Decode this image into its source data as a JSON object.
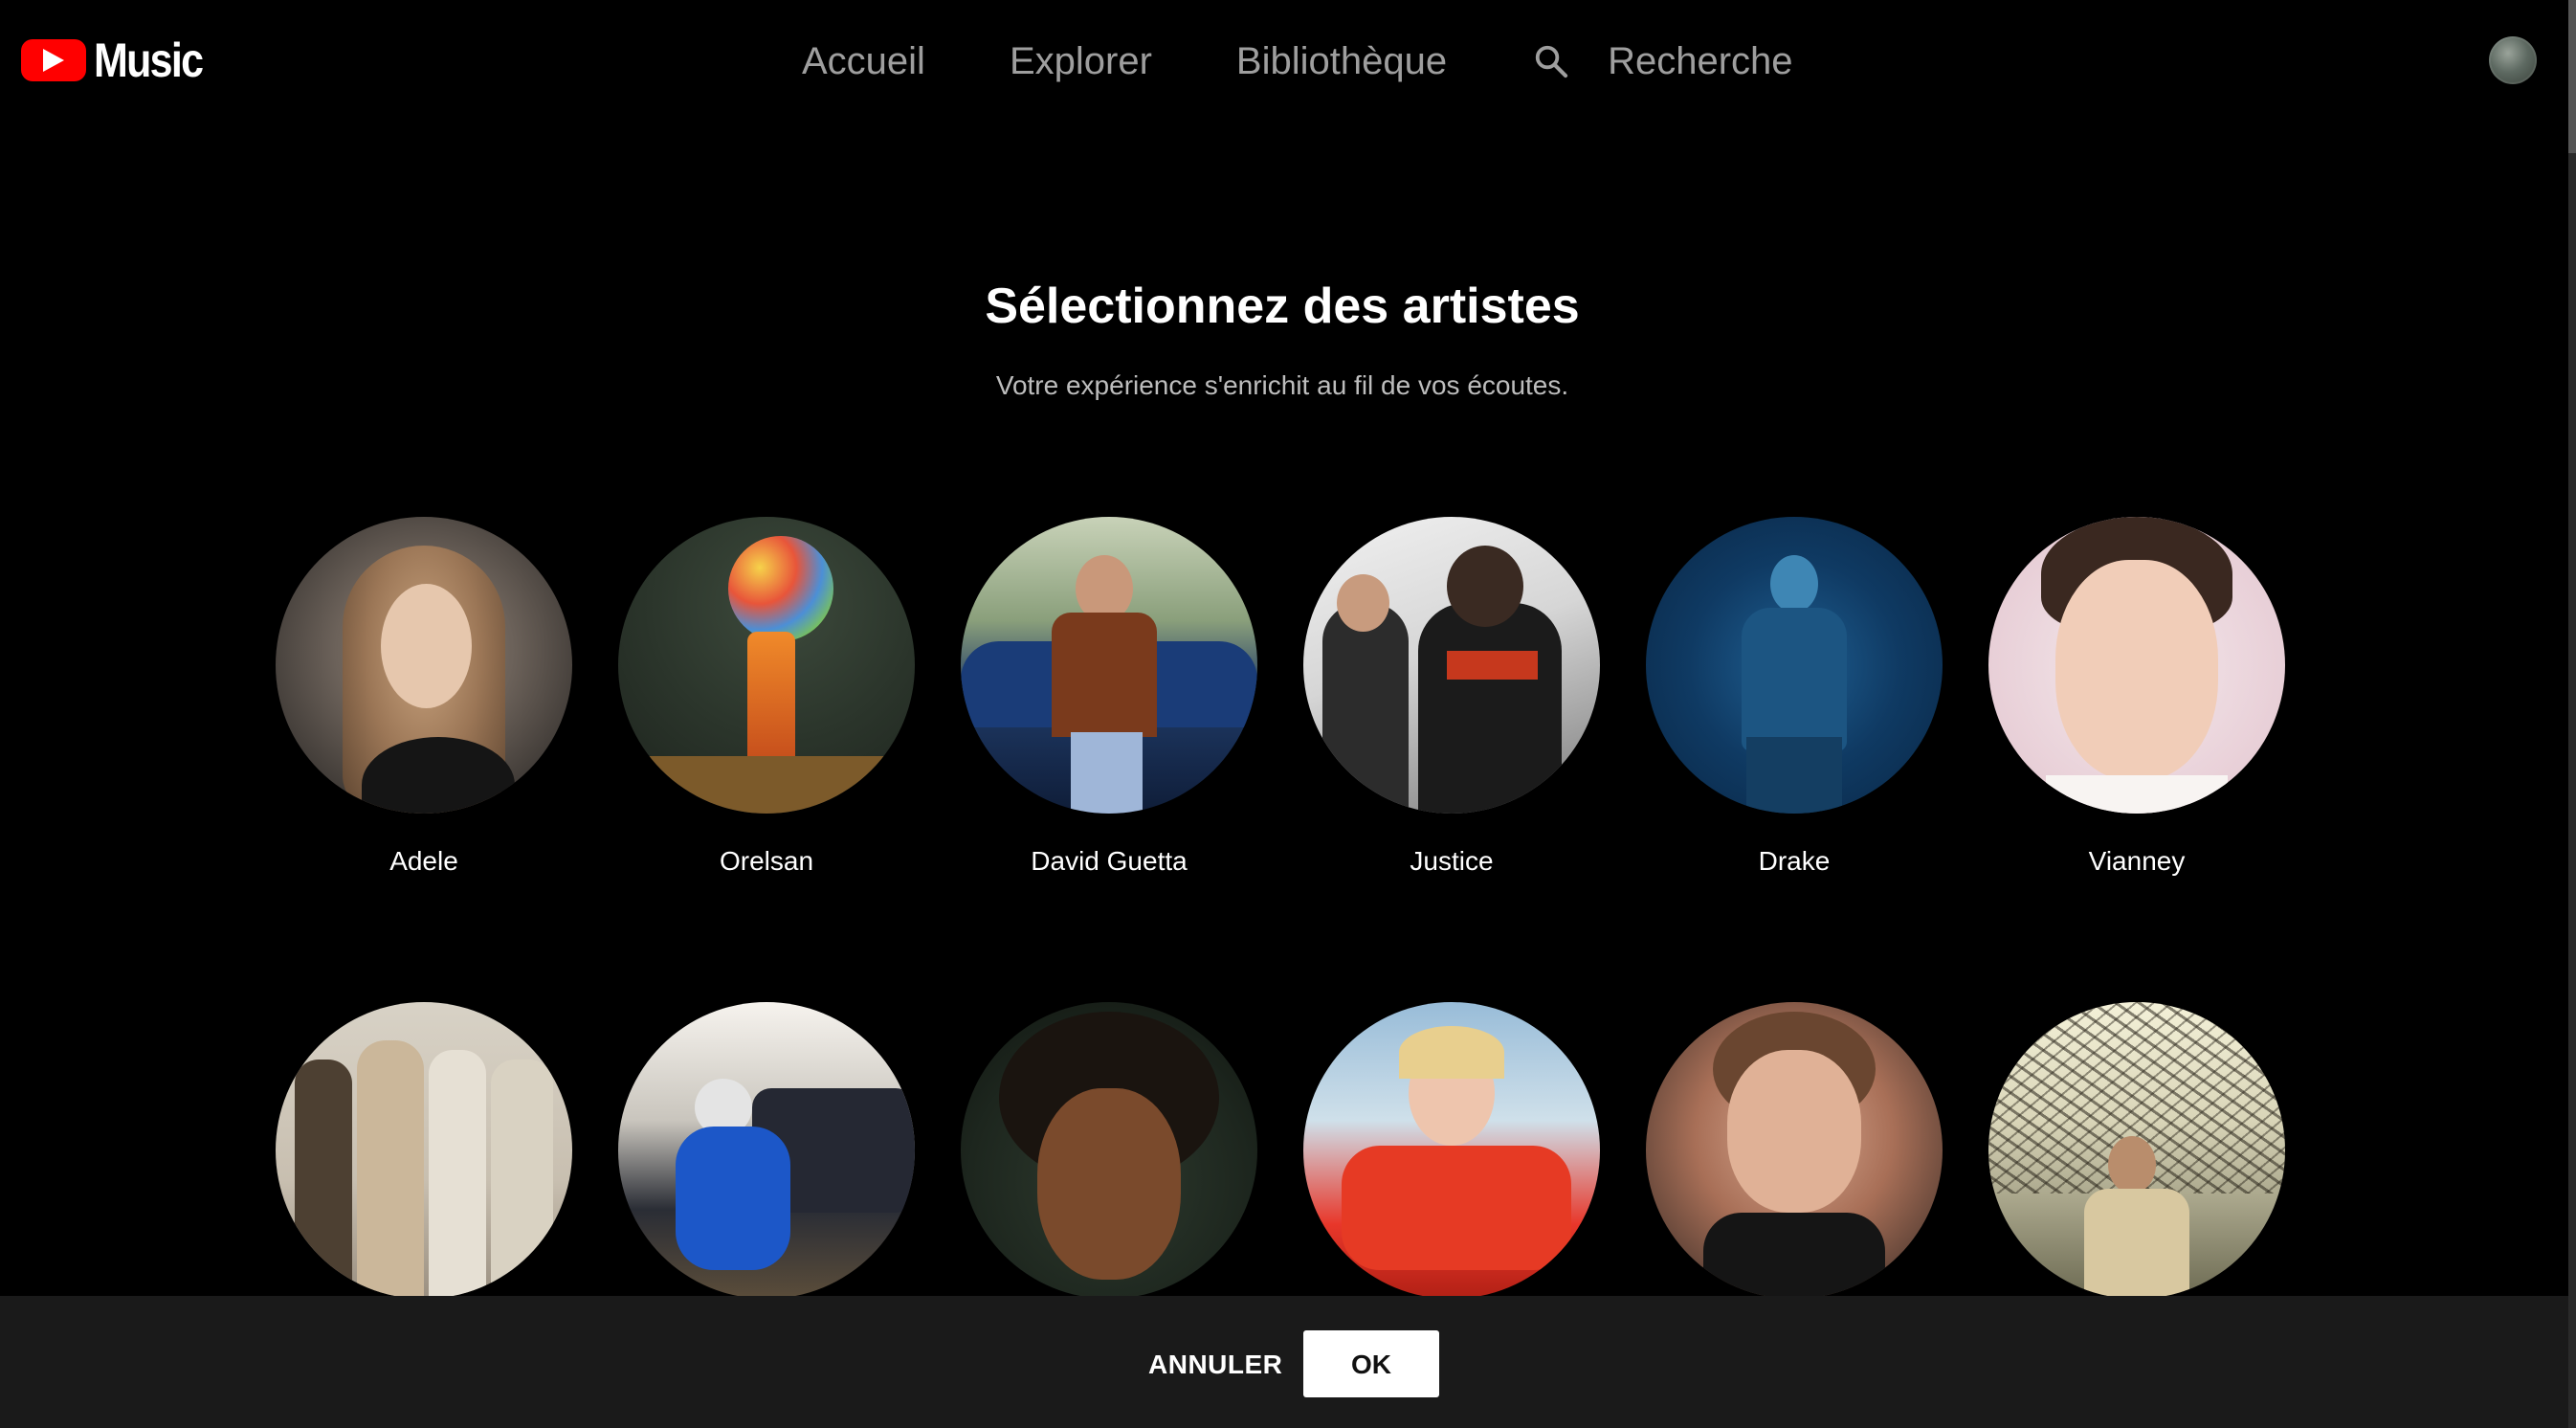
{
  "app": {
    "logo_text": "Music",
    "brand_color": "#ff0000"
  },
  "nav": {
    "items": [
      {
        "label": "Accueil"
      },
      {
        "label": "Explorer"
      },
      {
        "label": "Bibliothèque"
      }
    ],
    "search_label": "Recherche"
  },
  "page": {
    "title": "Sélectionnez des artistes",
    "subtitle": "Votre expérience s'enrichit au fil de vos écoutes."
  },
  "artists": [
    {
      "name": "Adele"
    },
    {
      "name": "Orelsan"
    },
    {
      "name": "David Guetta"
    },
    {
      "name": "Justice"
    },
    {
      "name": "Drake"
    },
    {
      "name": "Vianney"
    },
    {
      "name": ""
    },
    {
      "name": ""
    },
    {
      "name": ""
    },
    {
      "name": ""
    },
    {
      "name": ""
    },
    {
      "name": ""
    }
  ],
  "actions": {
    "cancel_label": "ANNULER",
    "ok_label": "OK"
  },
  "icons": {
    "logo": "youtube-play-icon",
    "search": "search-icon",
    "avatar": "account-avatar"
  }
}
